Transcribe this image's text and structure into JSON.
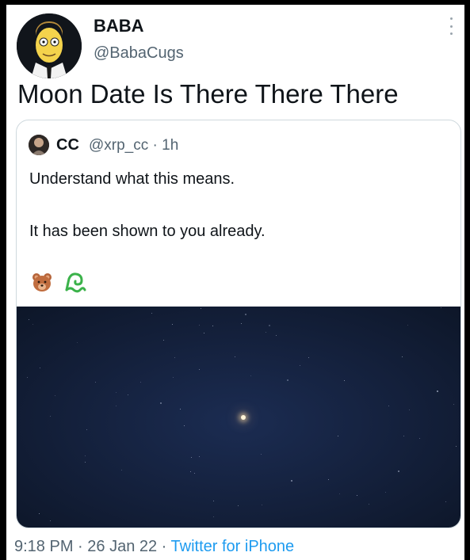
{
  "author": {
    "name": "BABA",
    "handle": "@BabaCugs"
  },
  "tweet": {
    "text": "Moon Date Is There There There"
  },
  "quoted": {
    "name": "CC",
    "handle": "@xrp_cc",
    "separator": "·",
    "age": "1h",
    "line1": "Understand what this means.",
    "line2": "It has been shown to you already.",
    "emojis": [
      "bear-emoji",
      "wave-emoji"
    ]
  },
  "footer": {
    "time": "9:18 PM",
    "sep1": " · ",
    "date": "26 Jan 22",
    "sep2": " · ",
    "app": "Twitter for iPhone"
  },
  "colors": {
    "text": "#0f1419",
    "secondary": "#536471",
    "link": "#1d9bf0",
    "border": "#cfd9de",
    "sky": "#15223f"
  }
}
